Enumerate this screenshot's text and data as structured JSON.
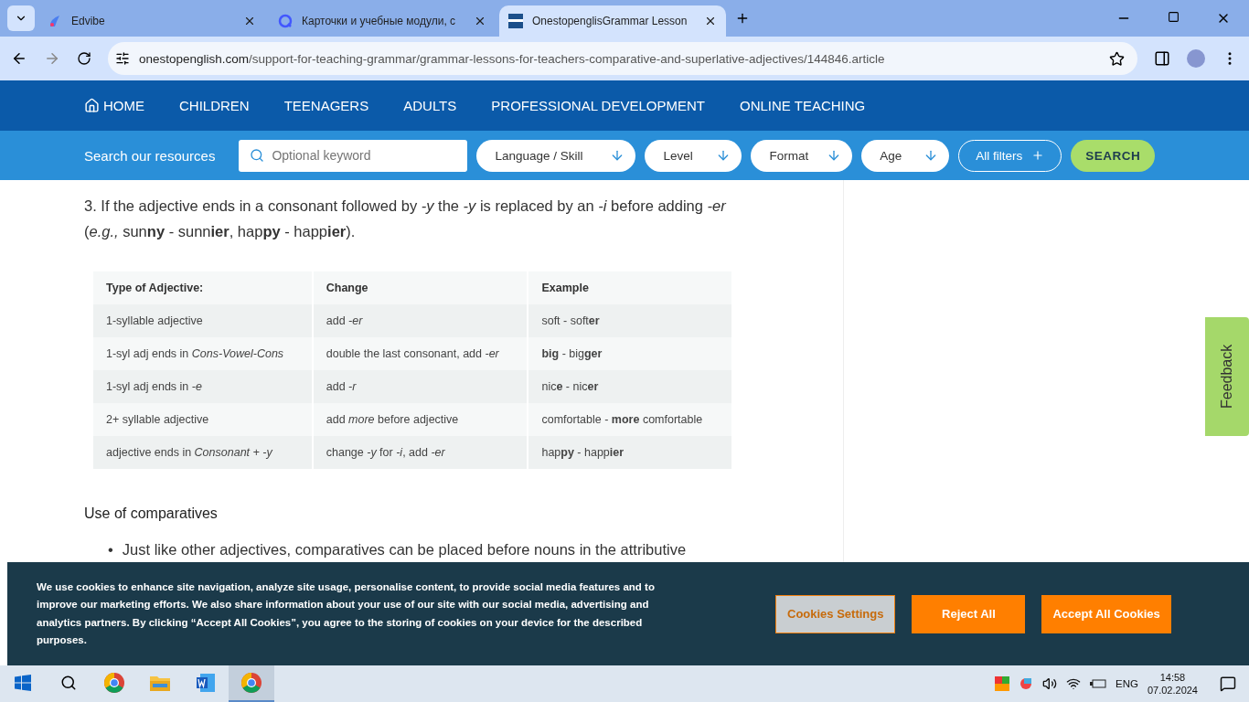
{
  "browser": {
    "tabs": [
      {
        "title": "Edvibe",
        "selected": false
      },
      {
        "title": "Карточки и учебные модули, с",
        "selected": false
      },
      {
        "title": "OnestopenglisGrammar Lesson",
        "selected": true
      }
    ],
    "url_host": "onestopenglish.com",
    "url_path": "/support-for-teaching-grammar/grammar-lessons-for-teachers-comparative-and-superlative-adjectives/144846.article"
  },
  "nav": {
    "items": [
      "HOME",
      "CHILDREN",
      "TEENAGERS",
      "ADULTS",
      "PROFESSIONAL DEVELOPMENT",
      "ONLINE TEACHING"
    ]
  },
  "search_bar": {
    "label": "Search our resources",
    "placeholder": "Optional keyword",
    "filters": [
      "Language / Skill",
      "Level",
      "Format",
      "Age"
    ],
    "all_filters": "All filters",
    "button": "SEARCH"
  },
  "article": {
    "paragraph": "3. If the adjective ends in a consonant followed by *-y* the *-y* is replaced by an *-i* before adding *-er* (*e.g.,* sun**ny** - sunn**ier**, hap**py** - happ**ier**).",
    "table": {
      "columns": [
        "Type of Adjective:",
        "Change",
        "Example"
      ],
      "rows": [
        [
          "1-syllable adjective",
          "add *-er*",
          "soft - soft**er**"
        ],
        [
          "1-syl adj ends in *Cons-Vowel-Cons*",
          "double the last consonant, add *-er*",
          "**big** - big**ger**"
        ],
        [
          "1-syl adj ends in *-e*",
          "add *-r*",
          "nic**e** - nic**er**"
        ],
        [
          "2+ syllable adjective",
          "add *more* before adjective",
          "comfortable - **more** comfortable"
        ],
        [
          "adjective ends in *Consonant + -y*",
          "change *-y* for *-i*, add *-er*",
          "hap**py** - happ**ier**"
        ]
      ]
    },
    "heading": "Use of comparatives",
    "bullets": [
      {
        "marker": "•",
        "text": "Just like other adjectives, comparatives can be placed before nouns in the attributive"
      }
    ]
  },
  "feedback": "Feedback",
  "cookies": {
    "text": "We use cookies to enhance site navigation, analyze site usage, personalise content, to provide social media features and to improve our marketing efforts. We also share information about your use of our site with our social media, advertising and analytics partners. By clicking “Accept All Cookies”, you agree to the storing of cookies on your device for the described purposes.",
    "buttons": [
      {
        "label": "Cookies Settings",
        "kind": "outline"
      },
      {
        "label": "Reject All",
        "kind": "solid"
      },
      {
        "label": "Accept All Cookies",
        "kind": "solid"
      }
    ]
  },
  "taskbar": {
    "apps": [
      {
        "kind": "chrome",
        "selected": false
      },
      {
        "kind": "folder",
        "selected": false
      },
      {
        "kind": "word",
        "selected": false
      },
      {
        "kind": "chrome",
        "selected": true
      }
    ],
    "language": "ENG",
    "time": "14:58",
    "date": "07.02.2024"
  }
}
